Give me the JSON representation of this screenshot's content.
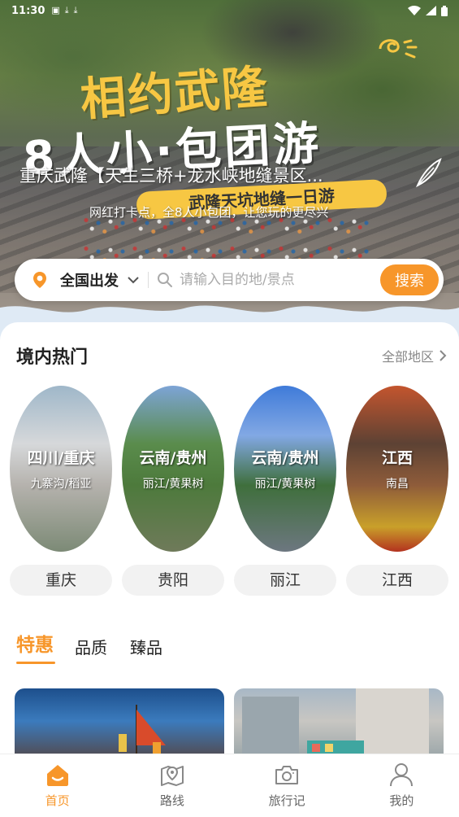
{
  "status_bar": {
    "time": "11:30",
    "icons": [
      "notification-icon",
      "download-icon",
      "download-icon"
    ],
    "right_icons": [
      "wifi-icon",
      "signal-icon",
      "battery-icon"
    ]
  },
  "hero": {
    "title_line1": "相约武隆",
    "title_line2": "8人小·包团游",
    "headline": "重庆武隆【天生三桥+龙水峡地缝景区...",
    "banner_text": "武隆天坑地缝一日游",
    "subtitle": "网红打卡点，全8人小包团，让您玩的更尽兴"
  },
  "search": {
    "location": "全国出发",
    "placeholder": "请输入目的地/景点",
    "button": "搜索"
  },
  "hot_section": {
    "title": "境内热门",
    "more": "全部地区",
    "regions": [
      {
        "name": "四川/重庆",
        "sub": "九寨沟/稻亚"
      },
      {
        "name": "云南/贵州",
        "sub": "丽江/黄果树"
      },
      {
        "name": "云南/贵州",
        "sub": "丽江/黄果树"
      },
      {
        "name": "江西",
        "sub": "南昌"
      }
    ],
    "cities": [
      "重庆",
      "贵阳",
      "丽江",
      "江西"
    ]
  },
  "tabs": [
    {
      "label": "特惠",
      "active": true
    },
    {
      "label": "品质",
      "active": false
    },
    {
      "label": "臻品",
      "active": false
    }
  ],
  "bottom_nav": [
    {
      "label": "首页",
      "icon": "home-icon",
      "active": true
    },
    {
      "label": "路线",
      "icon": "route-icon",
      "active": false
    },
    {
      "label": "旅行记",
      "icon": "camera-icon",
      "active": false
    },
    {
      "label": "我的",
      "icon": "user-icon",
      "active": false
    }
  ],
  "colors": {
    "accent": "#f7962a",
    "promo_yellow": "#f7c743"
  }
}
